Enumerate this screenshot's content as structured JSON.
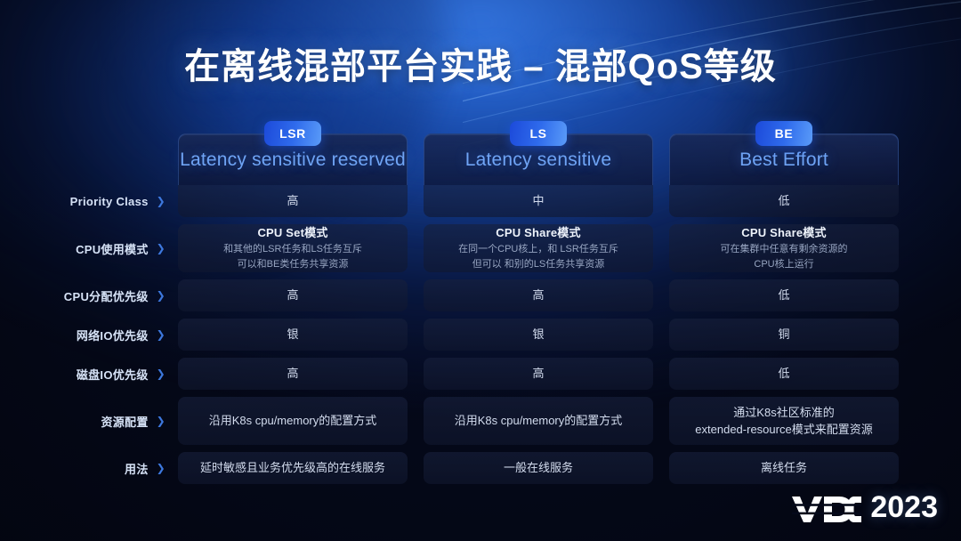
{
  "title": "在离线混部平台实践 – 混部QoS等级",
  "columns": [
    {
      "badge": "LSR",
      "title": "Latency sensitive reserved"
    },
    {
      "badge": "LS",
      "title": "Latency sensitive"
    },
    {
      "badge": "BE",
      "title": "Best Effort"
    }
  ],
  "rows": [
    {
      "label": "Priority Class",
      "size": "short",
      "cells": [
        {
          "value": "高"
        },
        {
          "value": "中"
        },
        {
          "value": "低"
        }
      ]
    },
    {
      "label": "CPU使用模式",
      "size": "tall",
      "cells": [
        {
          "title": "CPU Set模式",
          "sub1": "和其他的LSR任务和LS任务互斥",
          "sub2": "可以和BE类任务共享资源"
        },
        {
          "title": "CPU Share模式",
          "sub1": "在同一个CPU核上，和 LSR任务互斥",
          "sub2": "但可以 和别的LS任务共享资源"
        },
        {
          "title": "CPU Share模式",
          "sub1": "可在集群中任意有剩余资源的",
          "sub2": "CPU核上运行"
        }
      ]
    },
    {
      "label": "CPU分配优先级",
      "size": "short",
      "cells": [
        {
          "value": "高"
        },
        {
          "value": "高"
        },
        {
          "value": "低"
        }
      ]
    },
    {
      "label": "网络IO优先级",
      "size": "short",
      "cells": [
        {
          "value": "银"
        },
        {
          "value": "银"
        },
        {
          "value": "铜"
        }
      ]
    },
    {
      "label": "磁盘IO优先级",
      "size": "short",
      "cells": [
        {
          "value": "高"
        },
        {
          "value": "高"
        },
        {
          "value": "低"
        }
      ]
    },
    {
      "label": "资源配置",
      "size": "tall",
      "cells": [
        {
          "value": "沿用K8s cpu/memory的配置方式"
        },
        {
          "value": "沿用K8s cpu/memory的配置方式"
        },
        {
          "sub1": "通过K8s社区标准的",
          "sub2": "extended-resource模式来配置资源",
          "twoline": true
        }
      ]
    },
    {
      "label": "用法",
      "size": "short",
      "cells": [
        {
          "value": "延时敏感且业务优先级高的在线服务"
        },
        {
          "value": "一般在线服务"
        },
        {
          "value": "离线任务"
        }
      ]
    }
  ],
  "logo": {
    "mark": "VDC",
    "year": "2023"
  },
  "icons": {
    "chevron": "❯"
  },
  "colors": {
    "background": "#05091a",
    "glow": "#205cc8",
    "accent": "#2f6bec",
    "header_title": "#6fa4f5",
    "cell_text": "#d3dcee",
    "sub_text": "#98a6c2",
    "chevron": "#3d78de"
  }
}
